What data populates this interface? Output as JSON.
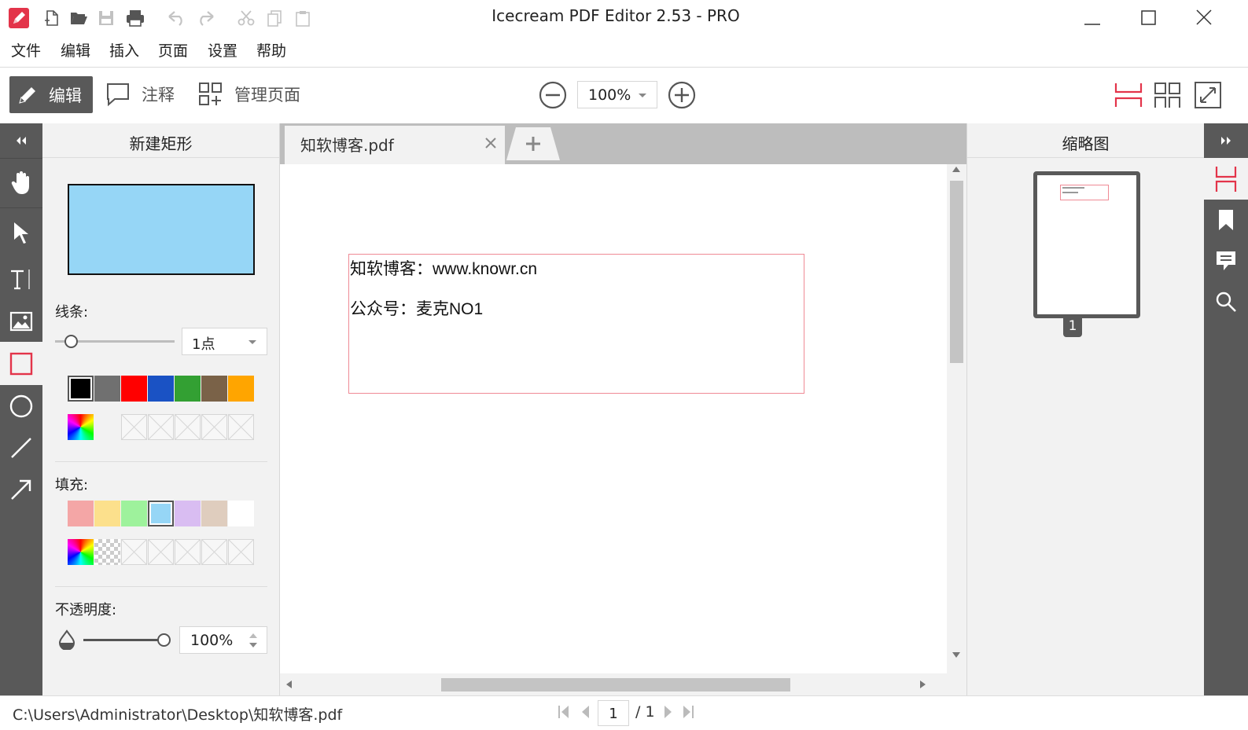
{
  "window": {
    "title": "Icecream PDF Editor 2.53 - PRO"
  },
  "menu": [
    "文件",
    "编辑",
    "插入",
    "页面",
    "设置",
    "帮助"
  ],
  "toolbar": {
    "edit_label": "编辑",
    "annotate_label": "注释",
    "manage_pages_label": "管理页面",
    "zoom_value": "100%"
  },
  "props": {
    "title": "新建矩形",
    "stroke_label": "线条:",
    "stroke_width": "1点",
    "stroke_colors": [
      "#000000",
      "#707070",
      "#ff0000",
      "#1a52c4",
      "#33a033",
      "#7a6248",
      "#ffa500"
    ],
    "fill_label": "填充:",
    "fill_colors": [
      "#f4a6a6",
      "#fce08c",
      "#9ef29c",
      "#96d6f6",
      "#d9bdf2",
      "#dfcdbe",
      "#ffffff"
    ],
    "opacity_label": "不透明度:",
    "opacity_value": "100%",
    "preview_fill": "#96d6f6"
  },
  "tab": {
    "filename": "知软博客.pdf"
  },
  "document": {
    "line1": "知软博客：www.knowr.cn",
    "line2": "公众号：麦克NO1"
  },
  "thumbnails": {
    "title": "缩略图",
    "page_label": "1"
  },
  "status": {
    "path": "C:\\Users\\Administrator\\Desktop\\知软博客.pdf",
    "current_page": "1",
    "total_pages": "/ 1"
  }
}
